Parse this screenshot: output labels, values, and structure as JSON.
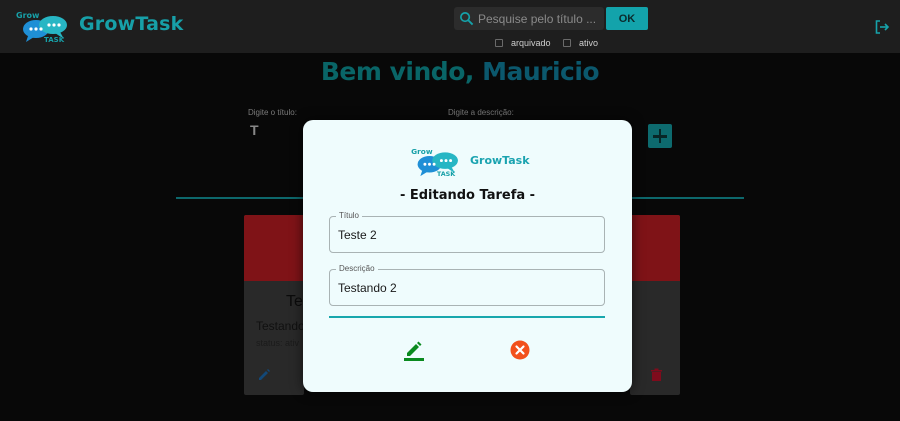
{
  "nav": {
    "logo_text": "GrowTask",
    "search_placeholder": "Pesquise pelo título ...",
    "search_button": "OK",
    "filter_archived": "arquivado",
    "filter_active": "ativo"
  },
  "page": {
    "welcome_prefix": "Bem vindo,",
    "welcome_name": "Mauricio",
    "title_field_label": "Digite o título:",
    "title_field_value": "T",
    "desc_field_label": "Digite a descrição:"
  },
  "card": {
    "title": "Te",
    "description": "Testando",
    "status": "status: ativ"
  },
  "modal": {
    "logo_text": "GrowTask",
    "heading": "- Editando Tarefa -",
    "title_label": "Título",
    "title_value": "Teste 2",
    "desc_label": "Descrição",
    "desc_value": "Testando 2"
  },
  "colors": {
    "accent": "#13a3ab",
    "card_header": "#c41e24",
    "save_green": "#0a8a1f",
    "cancel_orange": "#f2501c",
    "delete_red": "#c4122b"
  },
  "icons": {
    "search": "search-icon",
    "logout": "logout-icon",
    "add": "plus-icon",
    "edit": "pencil-icon",
    "cancel": "close-circle-icon",
    "delete": "trash-icon"
  }
}
